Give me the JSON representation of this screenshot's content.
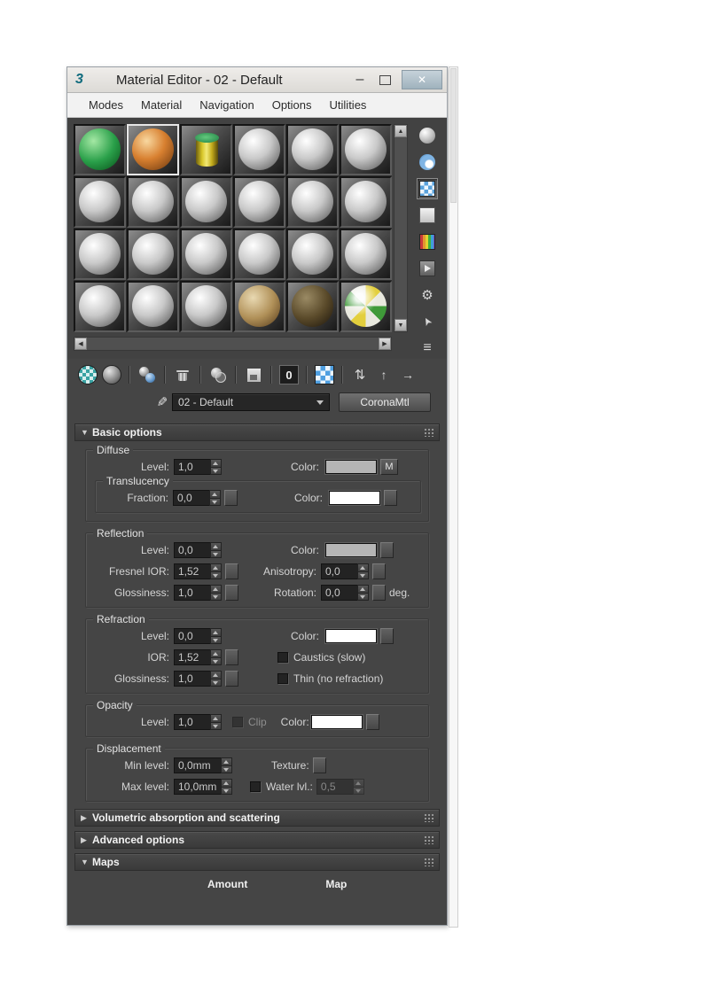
{
  "window": {
    "logo": "3",
    "title": "Material Editor - 02 - Default"
  },
  "glyphs": {
    "expanded": "▼",
    "collapsed": "▶",
    "up": "▲",
    "down": "▼",
    "left": "◀",
    "right": "▶",
    "eyedropper": "✎",
    "minimize": "–",
    "close": "✕"
  },
  "icon_glyphs": {
    "show-end-result": "⇅",
    "go-to-parent": "↑",
    "go-forward-to-sibling": "→",
    "options": "⚙",
    "select-by-material": "➤",
    "material-map-navigator": "≡"
  },
  "menu": {
    "items": [
      "Modes",
      "Material",
      "Navigation",
      "Options",
      "Utilities"
    ]
  },
  "samples": {
    "slot_types": [
      "green",
      "orange",
      "cylinder",
      "gray",
      "gray",
      "gray",
      "gray",
      "gray",
      "gray",
      "gray",
      "gray",
      "gray",
      "gray",
      "gray",
      "gray",
      "gray",
      "gray",
      "gray",
      "gray",
      "gray",
      "gray",
      "tan",
      "darkbrown",
      "multi"
    ],
    "active_index": 1
  },
  "side_toolbar": [
    {
      "name": "sample-type-sphere",
      "active": false
    },
    {
      "name": "backlight",
      "active": false
    },
    {
      "name": "background",
      "active": true
    },
    {
      "name": "sample-uv-tiling",
      "active": false
    },
    {
      "name": "video-color-check",
      "active": false
    },
    {
      "name": "generate-preview",
      "active": false
    },
    {
      "name": "options",
      "active": false
    },
    {
      "name": "select-by-material",
      "active": false
    },
    {
      "name": "material-map-navigator",
      "active": false
    }
  ],
  "main_toolbar": {
    "groups": [
      [
        "get-material",
        "put-material-to-scene"
      ],
      [
        "assign-material-to-selection"
      ],
      [
        "reset-material"
      ],
      [
        "make-material-copy"
      ],
      [
        "put-to-library"
      ],
      [
        "material-id-channel"
      ],
      [
        "show-map-in-viewport"
      ],
      [
        "show-end-result",
        "go-to-parent",
        "go-forward-to-sibling"
      ]
    ],
    "material_id_text": "0"
  },
  "material_bar": {
    "name": "02 - Default",
    "type_button": "CoronaMtl"
  },
  "rollouts": {
    "basic": "Basic options",
    "volumetric": "Volumetric absorption and scattering",
    "advanced": "Advanced options",
    "maps": "Maps"
  },
  "maps_columns": {
    "amount": "Amount",
    "map": "Map"
  },
  "basic": {
    "diffuse": {
      "legend": "Diffuse",
      "level_label": "Level:",
      "level": "1,0",
      "color_label": "Color:",
      "color_hex": "#b5b5b5",
      "map_button": "M"
    },
    "translucency": {
      "legend": "Translucency",
      "fraction_label": "Fraction:",
      "fraction": "0,0",
      "color_label": "Color:",
      "color_hex": "#ffffff"
    },
    "reflection": {
      "legend": "Reflection",
      "level_label": "Level:",
      "level": "0,0",
      "color_label": "Color:",
      "color_hex": "#b5b5b5",
      "fresnel_label": "Fresnel IOR:",
      "fresnel": "1,52",
      "anisotropy_label": "Anisotropy:",
      "anisotropy": "0,0",
      "glossiness_label": "Glossiness:",
      "glossiness": "1,0",
      "rotation_label": "Rotation:",
      "rotation": "0,0",
      "deg_label": "deg."
    },
    "refraction": {
      "legend": "Refraction",
      "level_label": "Level:",
      "level": "0,0",
      "color_label": "Color:",
      "color_hex": "#ffffff",
      "ior_label": "IOR:",
      "ior": "1,52",
      "caustics_label": "Caustics (slow)",
      "glossiness_label": "Glossiness:",
      "glossiness": "1,0",
      "thin_label": "Thin (no refraction)"
    },
    "opacity": {
      "legend": "Opacity",
      "level_label": "Level:",
      "level": "1,0",
      "clip_label": "Clip",
      "color_label": "Color:",
      "color_hex": "#ffffff"
    },
    "displacement": {
      "legend": "Displacement",
      "min_label": "Min level:",
      "min": "0,0mm",
      "texture_label": "Texture:",
      "max_label": "Max level:",
      "max": "10,0mm",
      "water_label": "Water lvl.:",
      "water": "0,5"
    }
  }
}
